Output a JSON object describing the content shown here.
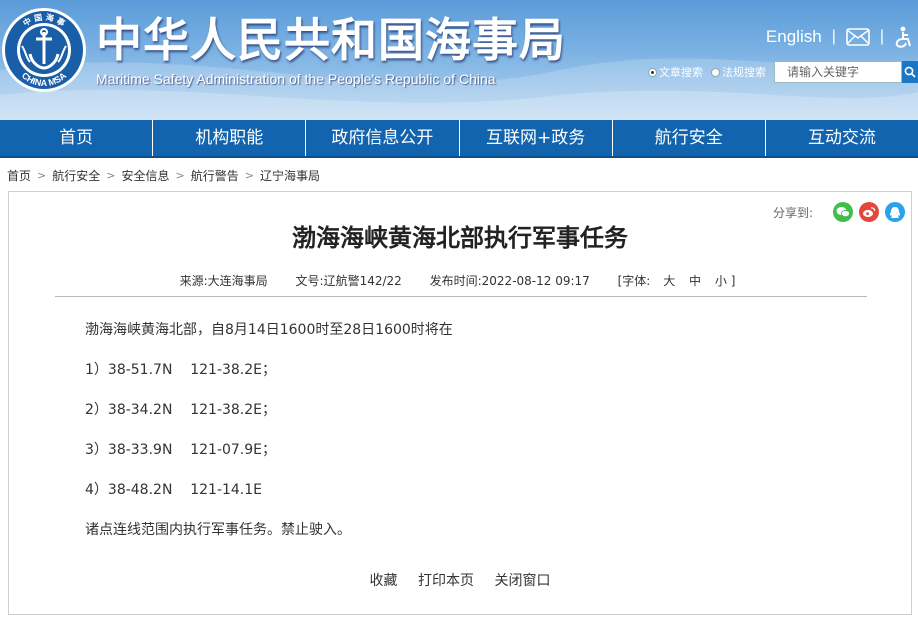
{
  "header": {
    "logo_text_top": "中 国 海 事",
    "logo_text_bottom": "CHINA MSA",
    "title_cn": "中华人民共和国海事局",
    "title_en": "Maritime Safety Administration of the People's Republic of China",
    "english_link": "English",
    "separator": "|",
    "mail_icon": "mail-icon",
    "accessibility_icon": "accessibility-icon",
    "search": {
      "option_article": "文章搜索",
      "option_law": "法规搜索",
      "placeholder": "请输入关键字",
      "selected": "文章搜索"
    }
  },
  "nav": {
    "items": [
      "首页",
      "机构职能",
      "政府信息公开",
      "互联网+政务",
      "航行安全",
      "互动交流"
    ]
  },
  "breadcrumb": {
    "items": [
      "首页",
      "航行安全",
      "安全信息",
      "航行警告",
      "辽宁海事局"
    ],
    "arrow": ">"
  },
  "share": {
    "label": "分享到:",
    "icons": [
      "wechat-icon",
      "weibo-icon",
      "qq-icon"
    ]
  },
  "article": {
    "title": "渤海海峡黄海北部执行军事任务",
    "meta": {
      "source_label": "来源:",
      "source": "大连海事局",
      "doc_label": "文号:",
      "doc_no": "辽航警142/22",
      "time_label": "发布时间:",
      "time": "2022-08-12 09:17",
      "font_label": "[字体:",
      "font_large": "大",
      "font_medium": "中",
      "font_small": "小 ]"
    },
    "paragraphs": [
      "渤海海峡黄海北部，自8月14日1600时至28日1600时将在",
      "1）38-51.7N    121-38.2E；",
      "2）38-34.2N    121-38.2E；",
      "3）38-33.9N    121-07.9E；",
      "4）38-48.2N    121-14.1E",
      "诸点连线范围内执行军事任务。禁止驶入。"
    ]
  },
  "actions": {
    "favorite": "收藏",
    "print": "打印本页",
    "close": "关闭窗口"
  },
  "colors": {
    "nav_bg": "#1264ae",
    "header_top": "#5b9bd8",
    "wechat": "#3fbf4a",
    "weibo": "#e5463b",
    "qq": "#2aa3ea"
  }
}
